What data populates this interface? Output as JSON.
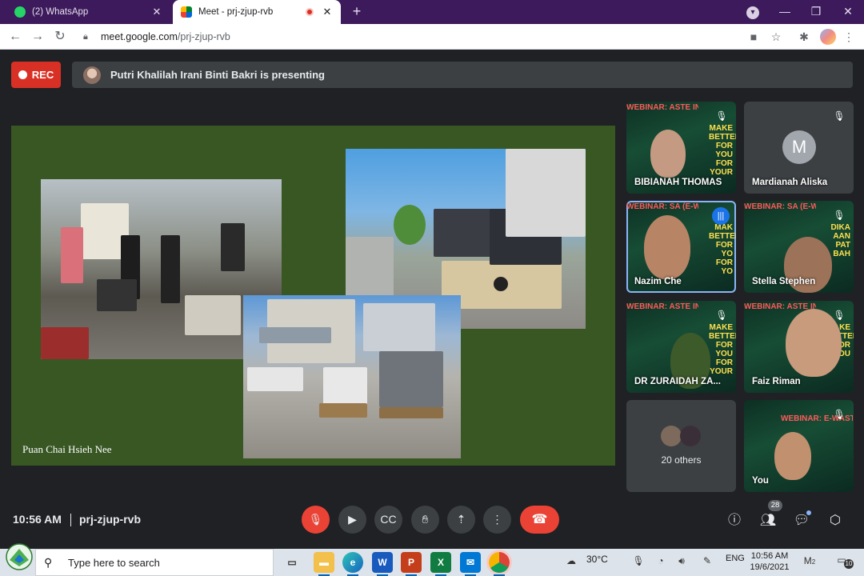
{
  "browser": {
    "tabs": [
      {
        "title": "(2) WhatsApp",
        "favicon": "whatsapp-icon",
        "color": "#25d366"
      },
      {
        "title": "Meet - prj-zjup-rvb",
        "favicon": "meet-icon",
        "color": "#00832d"
      }
    ],
    "close_glyph": "✕",
    "new_tab_glyph": "+",
    "url_host": "meet.google.com",
    "url_path": "/prj-zjup-rvb"
  },
  "meet": {
    "rec_label": "REC",
    "presenting_text": "Putri Khalilah Irani Binti Bakri is presenting",
    "slide_caption": "Puan Chai Hsieh Nee",
    "clock": "10:56 AM",
    "meeting_code": "prj-zjup-rvb",
    "participant_count": "28",
    "tiles": [
      {
        "name": "BIBIANAH THOMAS",
        "banner": "WEBINAR: ASTE IN SABAH",
        "side": "MAKE BETTER FOR YOU FOR YOUR"
      },
      {
        "name": "Mardianah Aliska",
        "initial": "M"
      },
      {
        "name": "Nazim Che",
        "banner": "WEBINAR: SA (E-WASTE) DI",
        "side": "MAK BETTER FOR YO FOR YO",
        "speaking": true
      },
      {
        "name": "Stella Stephen",
        "banner": "WEBINAR: SA (E-WASTE) DI SABAH",
        "side": "DIKA AAN PAT BAH"
      },
      {
        "name": "DR ZURAIDAH ZA...",
        "banner": "WEBINAR: ASTE IN SABAH",
        "side": "MAKE BETTER FOR YOU FOR YOUR"
      },
      {
        "name": "Faiz Riman",
        "banner": "WEBINAR: ASTE IN SABAH",
        "side": "MAKE BETTER FOR YOU"
      },
      {
        "name": "20 others"
      },
      {
        "name": "You",
        "banner": "WEBINAR: E-WASTE IN SABAH"
      }
    ]
  },
  "taskbar": {
    "search_placeholder": "Type here to search",
    "weather": "30°C",
    "lang": "ENG",
    "time": "10:56 AM",
    "date": "19/6/2021",
    "notif_count": "10",
    "mail_count": "2"
  }
}
